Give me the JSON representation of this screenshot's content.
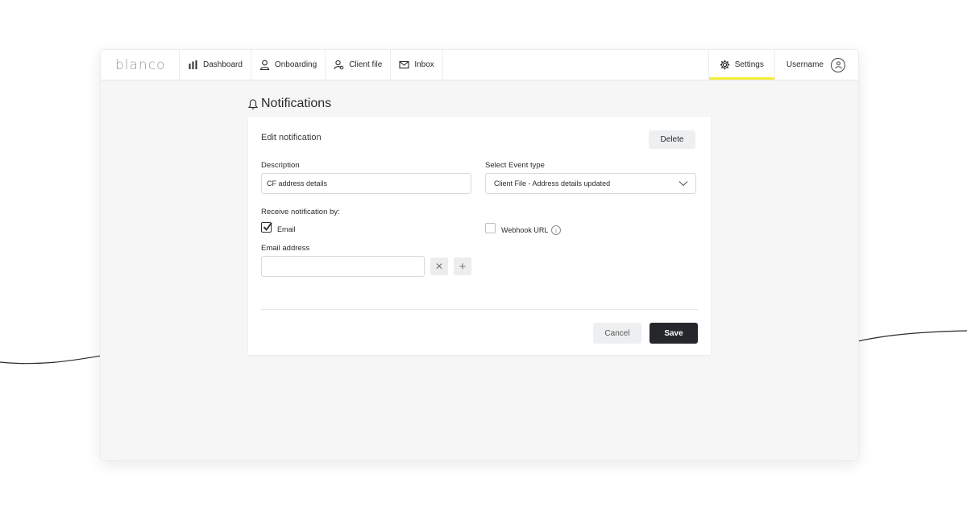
{
  "nav": {
    "logo": "blanco",
    "items": [
      {
        "label": "Dashboard",
        "icon": "bar-chart-icon"
      },
      {
        "label": "Onboarding",
        "icon": "user-icon"
      },
      {
        "label": "Client file",
        "icon": "client-search-icon"
      },
      {
        "label": "Inbox",
        "icon": "mail-icon"
      }
    ],
    "settings_label": "Settings",
    "settings_icon": "gear-icon",
    "username": "Username",
    "avatar_icon": "user-circle-icon",
    "active_color": "#f2ef36"
  },
  "page": {
    "title": "Notifications",
    "title_icon": "bell-icon"
  },
  "form": {
    "heading": "Edit notification",
    "delete_label": "Delete",
    "description_label": "Description",
    "description_value": "CF address details",
    "event_type_label": "Select Event type",
    "event_type_value": "Client File - Address details updated",
    "receive_label": "Receive notification by:",
    "email_option_label": "Email",
    "email_checked": true,
    "webhook_option_label": "Webhook URL",
    "webhook_checked": false,
    "email_address_label": "Email address",
    "email_address_value": "",
    "remove_symbol": "✕",
    "add_symbol": "+",
    "cancel_label": "Cancel",
    "save_label": "Save"
  }
}
